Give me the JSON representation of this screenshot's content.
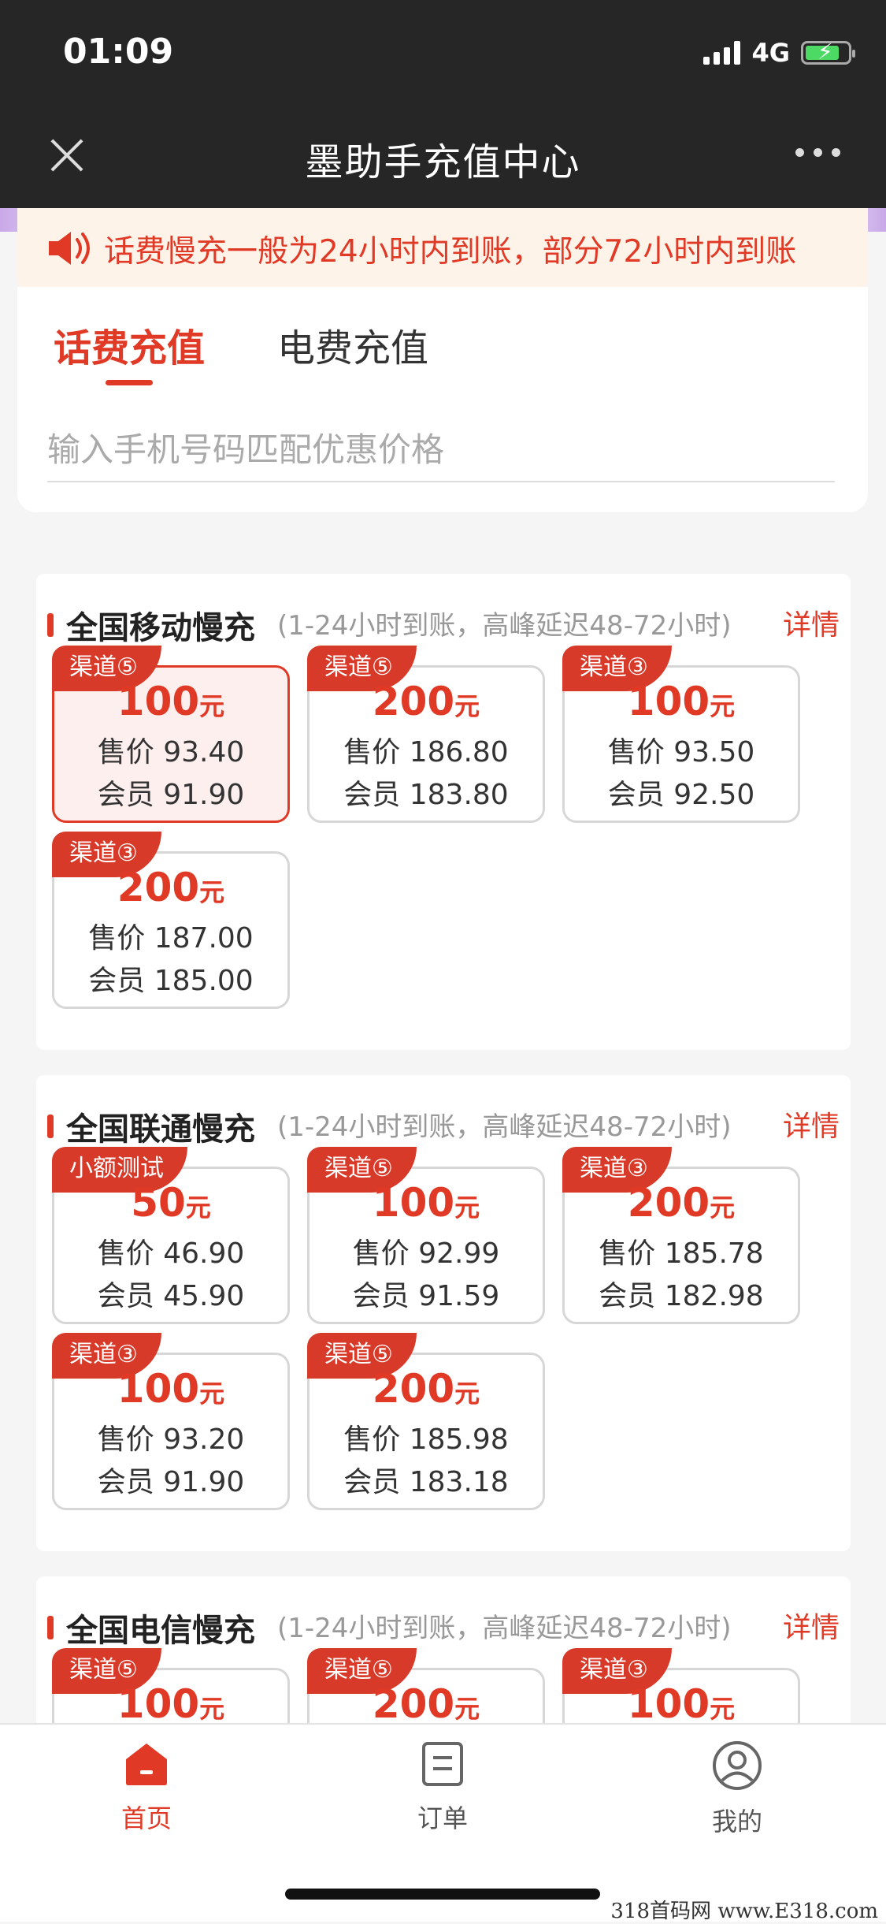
{
  "status": {
    "time": "01:09",
    "network": "4G"
  },
  "nav": {
    "title": "墨助手充值中心"
  },
  "notice": {
    "text": "话费慢充一般为24小时内到账，部分72小时内到账"
  },
  "tabs": [
    {
      "label": "话费充值",
      "active": true
    },
    {
      "label": "电费充值",
      "active": false
    }
  ],
  "search": {
    "placeholder": "输入手机号码匹配优惠价格",
    "value": ""
  },
  "unit_label": "元",
  "price_prefix": "售价",
  "member_prefix": "会员",
  "sections": [
    {
      "title": "全国移动慢充",
      "subtitle": "(1-24小时到账，高峰延迟48-72小时)",
      "detail_label": "详情",
      "packages": [
        {
          "badge": "渠道⑤",
          "amount": "100",
          "price": "93.40",
          "member": "91.90",
          "selected": true
        },
        {
          "badge": "渠道⑤",
          "amount": "200",
          "price": "186.80",
          "member": "183.80"
        },
        {
          "badge": "渠道③",
          "amount": "100",
          "price": "93.50",
          "member": "92.50"
        },
        {
          "badge": "渠道③",
          "amount": "200",
          "price": "187.00",
          "member": "185.00"
        }
      ]
    },
    {
      "title": "全国联通慢充",
      "subtitle": "(1-24小时到账，高峰延迟48-72小时)",
      "detail_label": "详情",
      "packages": [
        {
          "badge": "小额测试",
          "amount": "50",
          "price": "46.90",
          "member": "45.90"
        },
        {
          "badge": "渠道⑤",
          "amount": "100",
          "price": "92.99",
          "member": "91.59"
        },
        {
          "badge": "渠道③",
          "amount": "200",
          "price": "185.78",
          "member": "182.98"
        },
        {
          "badge": "渠道③",
          "amount": "100",
          "price": "93.20",
          "member": "91.90"
        },
        {
          "badge": "渠道⑤",
          "amount": "200",
          "price": "185.98",
          "member": "183.18"
        }
      ]
    },
    {
      "title": "全国电信慢充",
      "subtitle": "(1-24小时到账，高峰延迟48-72小时)",
      "detail_label": "详情",
      "packages": [
        {
          "badge": "渠道⑤",
          "amount": "100"
        },
        {
          "badge": "渠道⑤",
          "amount": "200"
        },
        {
          "badge": "渠道③",
          "amount": "100"
        }
      ]
    }
  ],
  "tabbar": [
    {
      "label": "首页",
      "icon": "home-icon",
      "active": true
    },
    {
      "label": "订单",
      "icon": "order-icon",
      "active": false
    },
    {
      "label": "我的",
      "icon": "profile-icon",
      "active": false
    }
  ],
  "watermark": "318首码网 www.E318.com",
  "colors": {
    "accent": "#e03a26",
    "navbar": "#262626",
    "notice_bg": "#fef3e9"
  }
}
